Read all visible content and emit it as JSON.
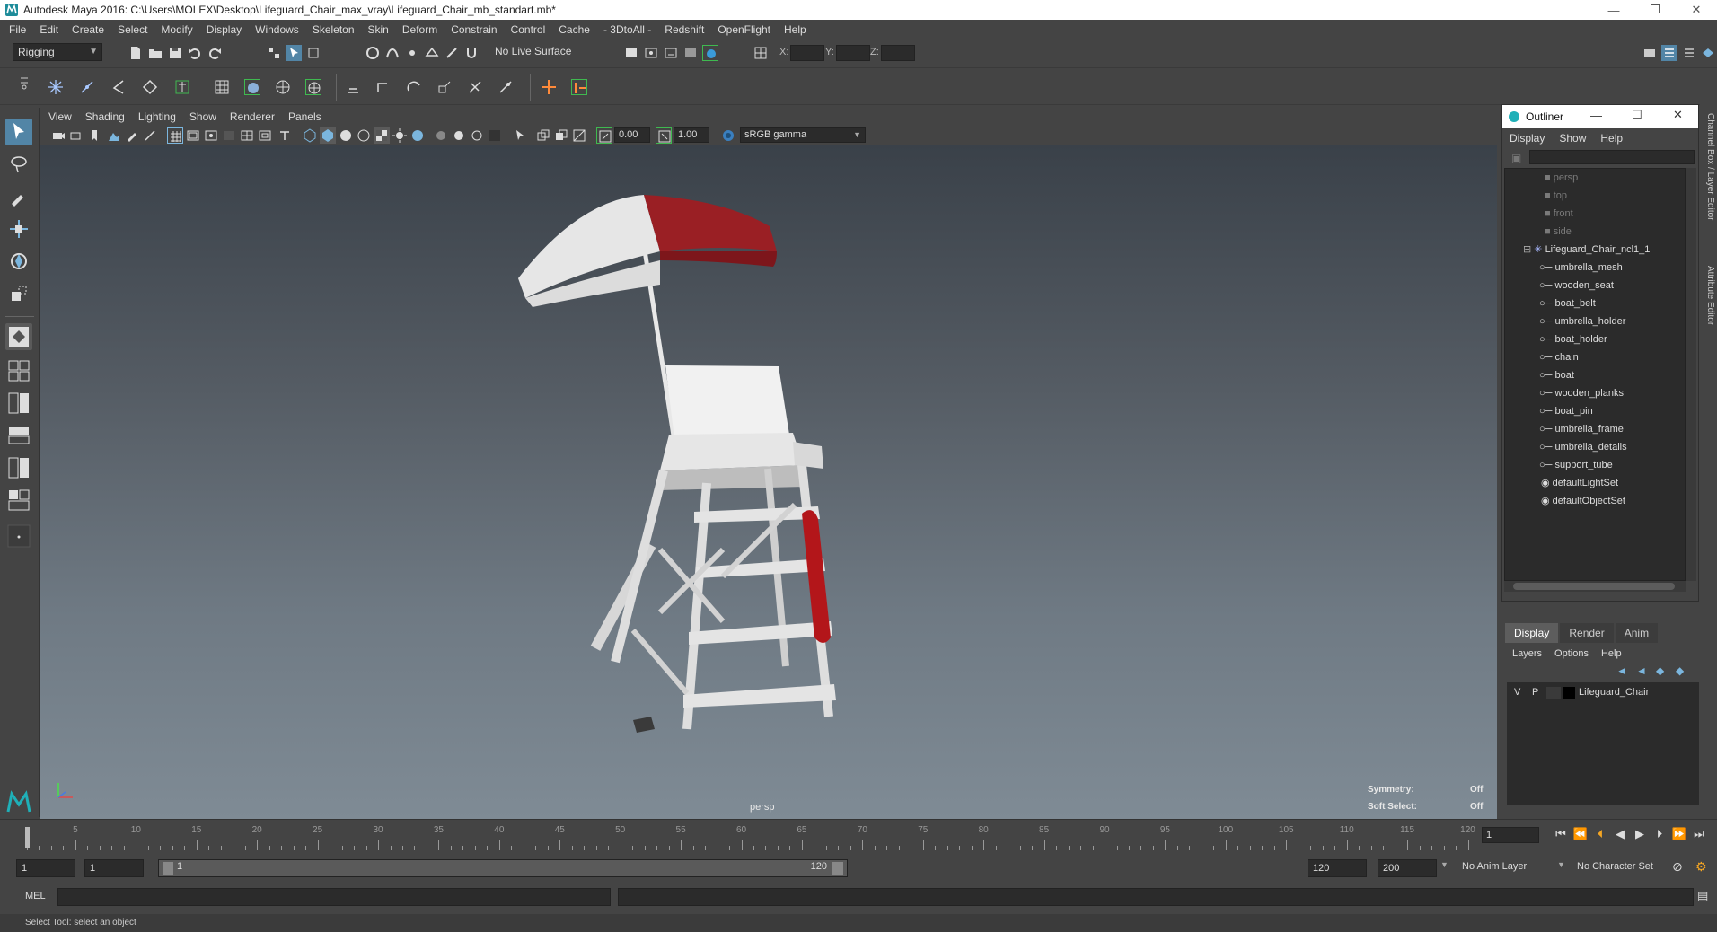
{
  "window": {
    "title": "Autodesk Maya 2016: C:\\Users\\MOLEX\\Desktop\\Lifeguard_Chair_max_vray\\Lifeguard_Chair_mb_standart.mb*",
    "minimize": "—",
    "restore": "❐",
    "close": "✕"
  },
  "menubar": [
    "File",
    "Edit",
    "Create",
    "Select",
    "Modify",
    "Display",
    "Windows",
    "Skeleton",
    "Skin",
    "Deform",
    "Constrain",
    "Control",
    "Cache",
    "- 3DtoAll -",
    "Redshift",
    "OpenFlight",
    "Help"
  ],
  "statusline": {
    "mode": "Rigging",
    "live_surface": "No Live Surface",
    "x_label": "X:",
    "y_label": "Y:",
    "z_label": "Z:"
  },
  "viewport": {
    "menu": [
      "View",
      "Shading",
      "Lighting",
      "Show",
      "Renderer",
      "Panels"
    ],
    "exposure": "0.00",
    "gamma": "1.00",
    "colorspace": "sRGB gamma",
    "camera_label": "persp",
    "hud": {
      "symmetry_label": "Symmetry:",
      "symmetry_value": "Off",
      "soft_select_label": "Soft Select:",
      "soft_select_value": "Off"
    }
  },
  "outliner": {
    "title": "Outliner",
    "menu": [
      "Display",
      "Show",
      "Help"
    ],
    "cameras": [
      "persp",
      "top",
      "front",
      "side"
    ],
    "root": "Lifeguard_Chair_ncl1_1",
    "children": [
      "umbrella_mesh",
      "wooden_seat",
      "boat_belt",
      "umbrella_holder",
      "boat_holder",
      "chain",
      "boat",
      "wooden_planks",
      "boat_pin",
      "umbrella_frame",
      "umbrella_details",
      "support_tube"
    ],
    "sets": [
      "defaultLightSet",
      "defaultObjectSet"
    ]
  },
  "sidetabs": [
    "Channel Box / Layer Editor",
    "Attribute Editor"
  ],
  "layers": {
    "tabs": [
      "Display",
      "Render",
      "Anim"
    ],
    "menu": [
      "Layers",
      "Options",
      "Help"
    ],
    "row": {
      "v": "V",
      "p": "P",
      "name": "Lifeguard_Chair"
    }
  },
  "timeline": {
    "ticks": [
      "5",
      "10",
      "15",
      "20",
      "25",
      "30",
      "35",
      "40",
      "45",
      "50",
      "55",
      "60",
      "65",
      "70",
      "75",
      "80",
      "85",
      "90",
      "95",
      "100",
      "105",
      "110",
      "115",
      "120"
    ],
    "start_tick": "1",
    "current_frame": "1"
  },
  "range": {
    "start": "1",
    "playback_start": "1",
    "slider_start": "1",
    "slider_end": "120",
    "playback_end": "120",
    "end": "200",
    "anim_layer": "No Anim Layer",
    "character_set": "No Character Set"
  },
  "commandline": {
    "label": "MEL"
  },
  "helpline": "Select Tool: select an object",
  "colors": {
    "accent": "#5285a6",
    "umbrella_red": "#9a1f24",
    "highlight_green": "#3fb950"
  }
}
